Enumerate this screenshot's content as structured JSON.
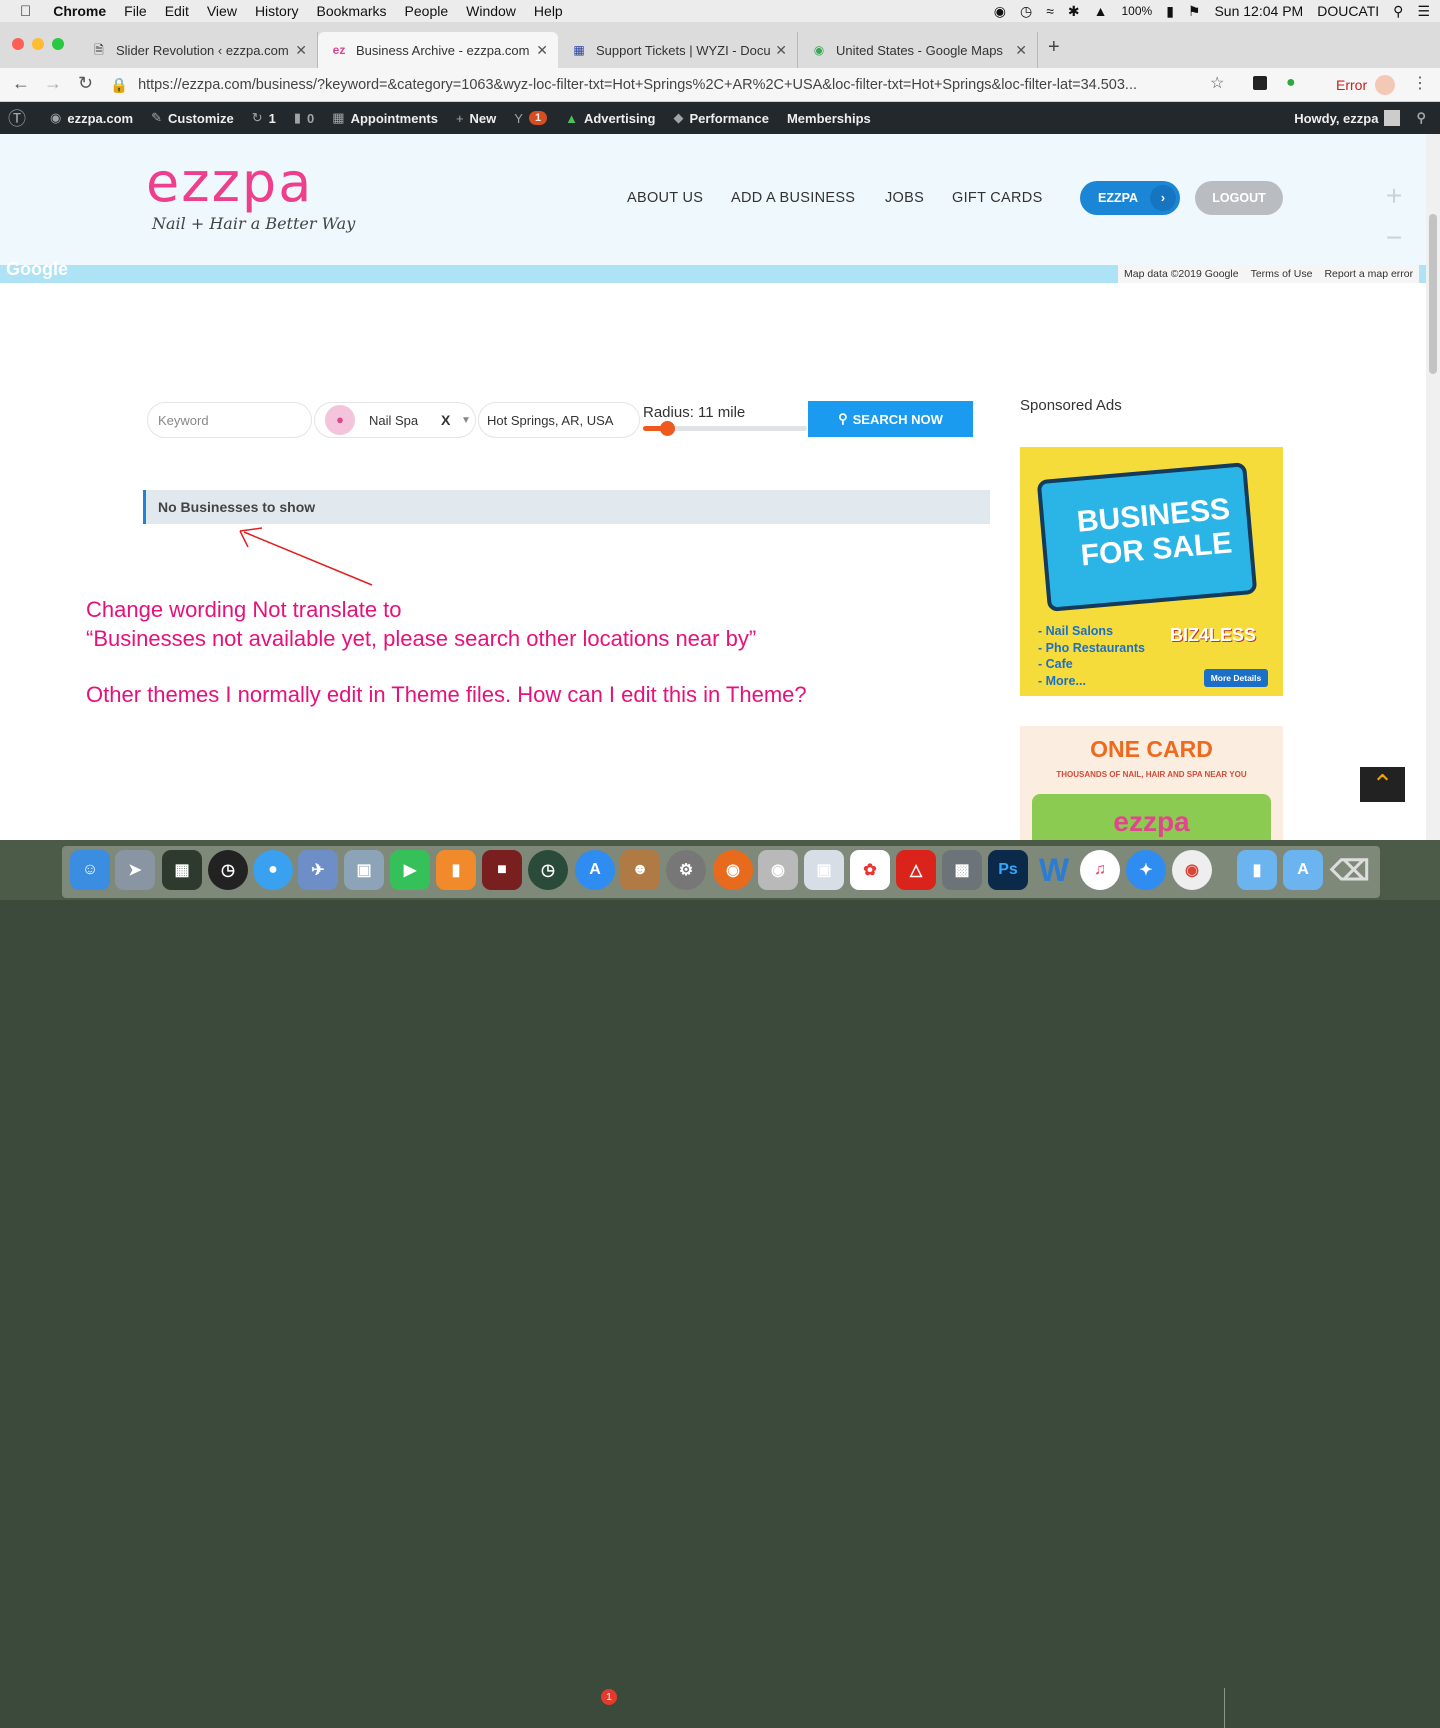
{
  "menubar": {
    "apple": "",
    "app": "Chrome",
    "items": [
      "File",
      "Edit",
      "View",
      "History",
      "Bookmarks",
      "People",
      "Window",
      "Help"
    ],
    "battery": "100%",
    "clock": "Sun 12:04 PM",
    "user": "DOUCATI"
  },
  "tabs": [
    {
      "icon": "page-icon",
      "label": "Slider Revolution ‹ ezzpa.com"
    },
    {
      "icon": "ez",
      "label": "Business Archive - ezzpa.com"
    },
    {
      "icon": "grid-icon",
      "label": "Support Tickets | WYZI - Docu"
    },
    {
      "icon": "maps-icon",
      "label": "United States - Google Maps"
    }
  ],
  "address": {
    "url": "https://ezzpa.com/business/?keyword=&category=1063&wyz-loc-filter-txt=Hot+Springs%2C+AR%2C+USA&loc-filter-txt=Hot+Springs&loc-filter-lat=34.503...",
    "error_label": "Error"
  },
  "wpbar": {
    "site": "ezzpa.com",
    "customize": "Customize",
    "updates": "1",
    "comments": "0",
    "appointments": "Appointments",
    "new": "New",
    "yoast_badge": "1",
    "advertising": "Advertising",
    "performance": "Performance",
    "memberships": "Memberships",
    "howdy": "Howdy, ezzpa"
  },
  "header": {
    "logo": "ezzpa",
    "tagline": "Nail + Hair a Better Way",
    "nav": [
      "ABOUT US",
      "ADD A BUSINESS",
      "JOBS",
      "GIFT CARDS"
    ],
    "ezzpa_button": "EZZPA",
    "logout_button": "LOGOUT",
    "map_zoom_in": "+",
    "map_zoom_out": "−",
    "google": "Google",
    "map_data": "Map data ©2019 Google",
    "terms": "Terms of Use",
    "report": "Report a map error"
  },
  "search": {
    "keyword_placeholder": "Keyword",
    "category": "Nail Spa",
    "clear": "X",
    "location": "Hot Springs, AR, USA",
    "radius_label": "Radius: 11 mile",
    "radius_value": 11,
    "button": "SEARCH NOW"
  },
  "results": {
    "empty_message": "No Businesses to show"
  },
  "annotation": {
    "line1": "Change wording Not translate to",
    "line2": "“Businesses not available yet, please search other locations near by”",
    "line3": "Other themes I normally edit in Theme files. How can I edit this in Theme?"
  },
  "sidebar": {
    "title": "Sponsored Ads",
    "ad1": {
      "headline1": "BUSINESS",
      "headline2": "FOR SALE",
      "list": [
        "- Nail Salons",
        "- Pho Restaurants",
        "- Cafe",
        "- More..."
      ],
      "brand": "BIZ4LESS",
      "button": "More Details"
    },
    "ad2": {
      "title": "ONE CARD",
      "subtitle": "THOUSANDS OF NAIL, HAIR AND SPA NEAR YOU",
      "logo": "ezzpa"
    }
  },
  "dock": {
    "app_store_badge": "1",
    "ps_label": "Ps",
    "word_label": "W"
  },
  "colors": {
    "accent_blue": "#1b86d6",
    "annotation_pink": "#e6117a",
    "wp_bar": "#23282d",
    "logo_pink": "#ee3f8c",
    "logo_cyan": "#1cb6e0"
  }
}
